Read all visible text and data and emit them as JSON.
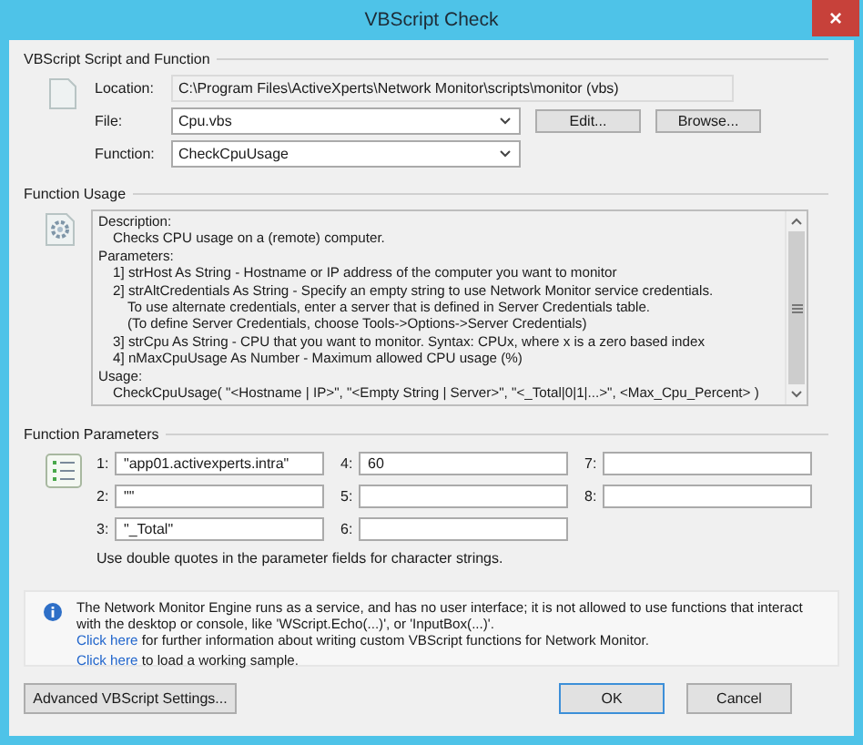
{
  "window": {
    "title": "VBScript Check",
    "close": "×"
  },
  "script_function": {
    "label": "VBScript Script and Function",
    "fields": [
      {
        "kind": "static",
        "label": "Location:",
        "value": "C:\\Program Files\\ActiveXperts\\Network Monitor\\scripts\\monitor (vbs)"
      },
      {
        "kind": "combo",
        "label": "File:",
        "value": "Cpu.vbs",
        "buttons": [
          "Edit...",
          "Browse..."
        ]
      },
      {
        "kind": "combo",
        "label": "Function:",
        "value": "CheckCpuUsage"
      }
    ]
  },
  "function_usage": {
    "label": "Function Usage",
    "sections": [
      {
        "heading": "Description:",
        "lines": [
          {
            "text": "Checks CPU usage on a (remote) computer."
          }
        ]
      },
      {
        "heading": "Parameters:",
        "lines": [
          {
            "text": "1] strHost As String  - Hostname or IP address of the computer you want to monitor"
          },
          {
            "text": "2] strAltCredentials As String - Specify an empty string to use Network Monitor service credentials.",
            "children": [
              {
                "text": "To use alternate credentials, enter a server that is defined in Server Credentials table."
              },
              {
                "text": "(To define Server Credentials, choose Tools->Options->Server Credentials)"
              }
            ]
          },
          {
            "text": "3] strCpu As String - CPU that you want to monitor. Syntax: CPUx, where x is a zero based index"
          },
          {
            "text": "4] nMaxCpuUsage As Number - Maximum allowed CPU usage (%)"
          }
        ]
      },
      {
        "heading": "Usage:",
        "lines": [
          {
            "text": "CheckCpuUsage( \"<Hostname | IP>\", \"<Empty String | Server>\", \"<_Total|0|1|...>\", <Max_Cpu_Percent> )"
          }
        ]
      }
    ]
  },
  "function_parameters": {
    "label": "Function Parameters",
    "params": [
      {
        "label": "1:",
        "value": "\"app01.activexperts.intra\""
      },
      {
        "label": "2:",
        "value": "\"\""
      },
      {
        "label": "3:",
        "value": "\"_Total\""
      },
      {
        "label": "4:",
        "value": "60"
      },
      {
        "label": "5:"
      },
      {
        "label": "6:"
      },
      {
        "label": "7:"
      },
      {
        "label": "8:"
      }
    ],
    "hint": "Use double quotes in the parameter fields for character strings."
  },
  "info": {
    "text": "The Network Monitor Engine runs as a service, and has no user interface; it is not allowed to use functions that interact with the desktop or console, like 'WScript.Echo(...)', or 'InputBox(...)'.",
    "links": [
      {
        "link": "Click here",
        "text": " for further information about writing custom VBScript functions for Network Monitor."
      },
      {
        "link": "Click here",
        "text": " to load a working sample."
      }
    ]
  },
  "buttons": [
    {
      "label": "Advanced VBScript Settings...",
      "kind": "left",
      "default": false
    },
    {
      "label": "OK",
      "kind": "right",
      "default": true
    },
    {
      "label": "Cancel",
      "kind": "right",
      "default": false
    }
  ]
}
